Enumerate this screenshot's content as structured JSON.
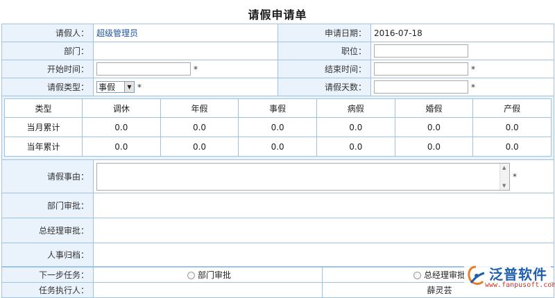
{
  "form": {
    "title": "请假申请单",
    "applicant_label": "请假人：",
    "applicant_value": "超级管理员",
    "date_label": "申请日期：",
    "date_value": "2016-07-18",
    "dept_label": "部门：",
    "dept_value": "",
    "position_label": "职位：",
    "start_label": "开始时间：",
    "end_label": "结束时间：",
    "type_label": "请假类型：",
    "type_value": "事假",
    "days_label": "请假天数：",
    "required_mark": "*"
  },
  "stats": {
    "headers": [
      "类型",
      "调休",
      "年假",
      "事假",
      "病假",
      "婚假",
      "产假"
    ],
    "rows": [
      {
        "label": "当月累计",
        "values": [
          "0.0",
          "0.0",
          "0.0",
          "0.0",
          "0.0",
          "0.0"
        ]
      },
      {
        "label": "当年累计",
        "values": [
          "0.0",
          "0.0",
          "0.0",
          "0.0",
          "0.0",
          "0.0"
        ]
      }
    ]
  },
  "approval": {
    "reason_label": "请假事由：",
    "dept_approval_label": "部门审批：",
    "gm_approval_label": "总经理审批：",
    "hr_archive_label": "人事归档："
  },
  "workflow": {
    "next_task_label": "下一步任务：",
    "option_dept": "部门审批",
    "option_gm": "总经理审批",
    "executor_label": "任务执行人：",
    "executor_value": "薛灵芸"
  },
  "logo": {
    "name": "泛普软件",
    "url": "www.fanpusoft.com",
    "icon": "fanpu-logo-icon"
  },
  "colors": {
    "border": "#9cc3e6",
    "label_bg": "#eaf3fc",
    "link": "#2156a5"
  }
}
